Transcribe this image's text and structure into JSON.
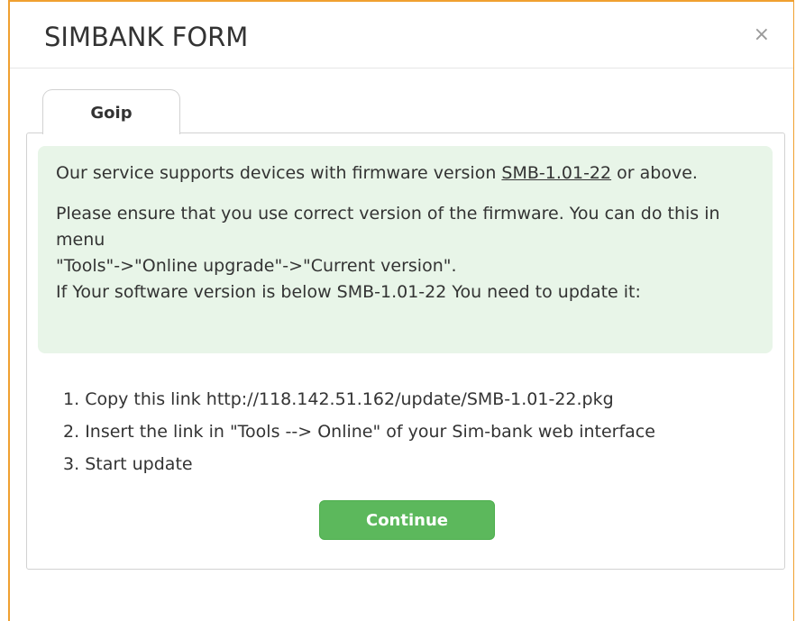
{
  "modal": {
    "title": "SIMBANK FORM",
    "close_label": "×"
  },
  "tabs": [
    {
      "label": "Goip",
      "active": true
    }
  ],
  "notice": {
    "support_prefix": "Our service supports devices with firmware version ",
    "firmware_version": "SMB-1.01-22",
    "support_suffix": " or above.",
    "instruction_line1": "Please ensure that you use correct version of the firmware. You can do this in menu",
    "instruction_line2": "\"Tools\"->\"Online upgrade\"->\"Current version\".",
    "instruction_line3": "If Your software version is below SMB-1.01-22 You need to update it:"
  },
  "steps": [
    {
      "number": "1.",
      "text": "Copy this link http://118.142.51.162/update/SMB-1.01-22.pkg"
    },
    {
      "number": "2.",
      "text": "Insert the link in \"Tools --> Online\" of your Sim-bank web interface"
    },
    {
      "number": "3.",
      "text": "Start update"
    }
  ],
  "actions": {
    "continue_label": "Continue"
  },
  "colors": {
    "modal_border": "#f0a030",
    "notice_background": "#e8f5e8",
    "continue_button": "#5cb85c",
    "text": "#333333"
  }
}
